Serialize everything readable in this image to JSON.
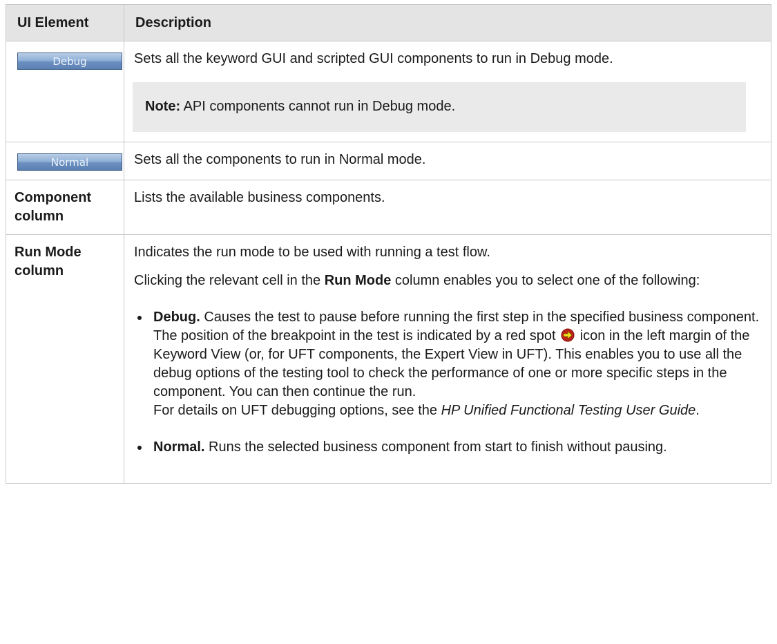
{
  "table": {
    "headers": {
      "element": "UI Element",
      "description": "Description"
    },
    "rows": {
      "debug": {
        "button_label": "Debug",
        "description": "Sets all the keyword GUI and scripted GUI components to run in Debug mode.",
        "note_label": "Note:",
        "note_text": " API components cannot run in Debug mode."
      },
      "normal": {
        "button_label": "Normal",
        "description": "Sets all the components to run in Normal mode."
      },
      "component": {
        "element": "Component column",
        "description": "Lists the available business components."
      },
      "run_mode": {
        "element": "Run Mode column",
        "description": "Indicates the run mode to be used with running a test flow.",
        "click_prefix": "Clicking the relevant cell in the ",
        "click_bold": "Run Mode",
        "click_suffix": " column enables you to select one of the following:",
        "debug_item": {
          "term": "Debug.",
          "text_before_icon": " Causes the test to pause before running the first step in the specified business component. The position of the breakpoint in the test is indicated by a red spot ",
          "icon": "breakpoint-icon",
          "text_after_icon": " icon in the left margin of the Keyword View (or, for UFT components, the Expert View in UFT). This enables you to use all the debug options of the testing tool to check the performance of one or more specific steps in the component. You can then continue the run.",
          "details_prefix": "For details on UFT debugging options, see the ",
          "details_italic": "HP Unified Functional Testing User Guide",
          "details_suffix": "."
        },
        "normal_item": {
          "term": "Normal.",
          "text": " Runs the selected business component from start to finish without pausing."
        }
      }
    }
  },
  "colors": {
    "header_bg": "#e4e4e4",
    "border": "#c8c8c8",
    "note_bg": "#eaeaea",
    "button_blue": "#6c90c0",
    "breakpoint_red": "#c0201a",
    "breakpoint_arrow": "#f5e21a"
  }
}
